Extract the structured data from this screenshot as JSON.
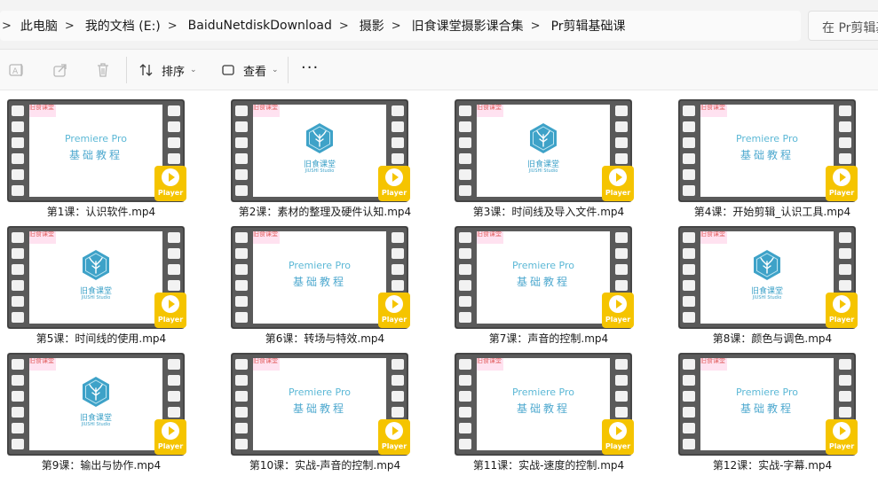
{
  "breadcrumb": {
    "items": [
      "此电脑",
      "我的文档 (E:)",
      "BaiduNetdiskDownload",
      "摄影",
      "旧食课堂摄影课合集",
      "Pr剪辑基础课"
    ],
    "search_placeholder": "在 Pr剪辑基"
  },
  "toolbar": {
    "sort_label": "排序",
    "view_label": "查看",
    "more_label": "···"
  },
  "badge_text": "Player",
  "thumb_watermark": "旧食课堂",
  "files": [
    {
      "name": "第1课：认识软件.mp4",
      "thumb": "title",
      "title": "Premiere Pro",
      "subtitle": "基础教程"
    },
    {
      "name": "第2课：素材的整理及硬件认知.mp4",
      "thumb": "logo",
      "logo_name": "旧食课堂",
      "logo_en": "JIUSHI Studio"
    },
    {
      "name": "第3课：时间线及导入文件.mp4",
      "thumb": "logo",
      "logo_name": "旧食课堂",
      "logo_en": "JIUSHI Studio"
    },
    {
      "name": "第4课：开始剪辑_认识工具.mp4",
      "thumb": "title",
      "title": "Premiere Pro",
      "subtitle": "基础教程"
    },
    {
      "name": "第5课：时间线的使用.mp4",
      "thumb": "logo",
      "logo_name": "旧食课堂",
      "logo_en": "JIUSHI Studio"
    },
    {
      "name": "第6课：转场与特效.mp4",
      "thumb": "title",
      "title": "Premiere Pro",
      "subtitle": "基础教程"
    },
    {
      "name": "第7课：声音的控制.mp4",
      "thumb": "title",
      "title": "Premiere Pro",
      "subtitle": "基础教程"
    },
    {
      "name": "第8课：颜色与调色.mp4",
      "thumb": "logo",
      "logo_name": "旧食课堂",
      "logo_en": "JIUSHI Studio"
    },
    {
      "name": "第9课：输出与协作.mp4",
      "thumb": "logo",
      "logo_name": "旧食课堂",
      "logo_en": "JIUSHI Studio"
    },
    {
      "name": "第10课：实战-声音的控制.mp4",
      "thumb": "title",
      "title": "Premiere Pro",
      "subtitle": "基础教程"
    },
    {
      "name": "第11课：实战-速度的控制.mp4",
      "thumb": "title",
      "title": "Premiere Pro",
      "subtitle": "基础教程"
    },
    {
      "name": "第12课：实战-字幕.mp4",
      "thumb": "title",
      "title": "Premiere Pro",
      "subtitle": "基础教程"
    }
  ],
  "colors": {
    "badge": "#f5c400",
    "film_frame": "#555555",
    "title_text": "#5cb8d6",
    "logo": "#3ea2c8"
  }
}
